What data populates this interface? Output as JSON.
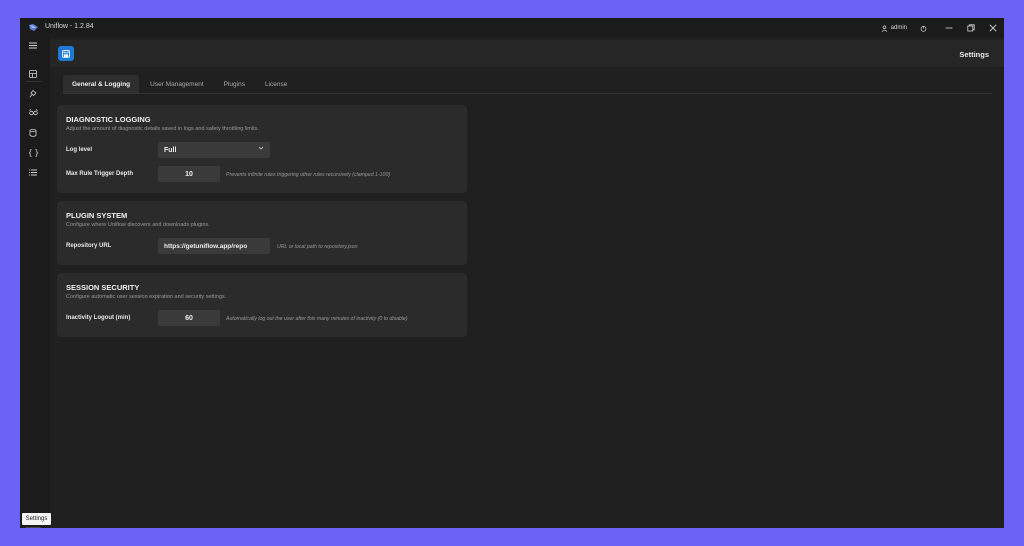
{
  "app": {
    "title": "Uniflow - 1.2.84"
  },
  "titlebar": {
    "user": "admin",
    "controls": [
      "minimize",
      "maximize",
      "close"
    ]
  },
  "sidebar": {
    "items": [
      {
        "icon": "menu-icon"
      },
      {
        "icon": "dashboard-icon"
      },
      {
        "icon": "rule-icon"
      },
      {
        "icon": "link-icon"
      },
      {
        "icon": "database-icon"
      },
      {
        "icon": "code-braces-icon"
      },
      {
        "icon": "list-icon"
      }
    ],
    "settings_tooltip": "Settings"
  },
  "header": {
    "page_title": "Settings"
  },
  "tabs": [
    {
      "label": "General & Logging",
      "active": true
    },
    {
      "label": "User Management",
      "active": false
    },
    {
      "label": "Plugins",
      "active": false
    },
    {
      "label": "License",
      "active": false
    }
  ],
  "sections": {
    "diagnostic": {
      "title": "DIAGNOSTIC LOGGING",
      "description": "Adjust the amount of diagnostic details saved in logs and safety throttling limits.",
      "log_level_label": "Log level",
      "log_level_value": "Full",
      "depth_label": "Max Rule Trigger Depth",
      "depth_value": "10",
      "depth_hint": "Prevents infinite rules triggering other rules recursively (clamped 1-100)"
    },
    "plugin": {
      "title": "PLUGIN SYSTEM",
      "description": "Configure where Uniflow discovers and downloads plugins.",
      "repo_label": "Repository URL",
      "repo_value": "https://getuniflow.app/repo",
      "repo_hint": "URL or local path to repository.json"
    },
    "session": {
      "title": "SESSION SECURITY",
      "description": "Configure automatic user session expiration and security settings.",
      "inactivity_label": "Inactivity Logout (min)",
      "inactivity_value": "60",
      "inactivity_hint": "Automatically log out the user after this many minutes of inactivity (0 to disable)"
    }
  },
  "colors": {
    "accent": "#1f7ad6",
    "background": "#6b63f5",
    "window": "#202020",
    "card": "#2b2b2b"
  }
}
